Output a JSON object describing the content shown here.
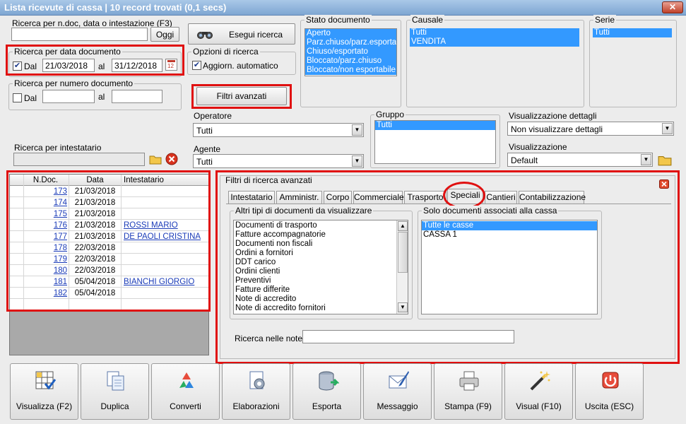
{
  "window": {
    "title": "Lista ricevute di cassa | 10 record trovati (0,1 secs)",
    "close": "✕"
  },
  "search": {
    "ndoc_label": "Ricerca per n.doc, data o intestazione (F3)",
    "ndoc_value": "",
    "oggi_label": "Oggi",
    "eseguiricerca_label": "Esegui ricerca",
    "date_group_label": "Ricerca per data documento",
    "date_dal_label": "Dal",
    "date_dal_checked": true,
    "date_from": "21/03/2018",
    "date_al_label": "al",
    "date_to": "31/12/2018",
    "calendar_icon_text": "12",
    "number_group_label": "Ricerca per numero documento",
    "num_dal_label": "Dal",
    "num_dal_checked": false,
    "num_from": "",
    "num_al_label": "al",
    "num_to": "",
    "intestatario_label": "Ricerca per intestatario",
    "intestatario_value": ""
  },
  "options": {
    "group_label": "Opzioni di ricerca",
    "auto_update_label": "Aggiorn. automatico",
    "auto_update_checked": true,
    "filtri_avanzati_label": "Filtri avanzati"
  },
  "stato": {
    "label": "Stato documento",
    "items": [
      "Aperto",
      "Parz.chiuso/parz.esportato",
      "Chiuso/esportato",
      "Bloccato/parz.chiuso",
      "Bloccato/non esportabile"
    ]
  },
  "causale": {
    "label": "Causale",
    "items": [
      "Tutti",
      "VENDITA"
    ]
  },
  "serie": {
    "label": "Serie",
    "items": [
      "Tutti"
    ]
  },
  "operatore": {
    "label": "Operatore",
    "value": "Tutti"
  },
  "agente": {
    "label": "Agente",
    "value": "Tutti"
  },
  "gruppo": {
    "label": "Gruppo",
    "items": [
      "Tutti"
    ]
  },
  "vis_dettagli": {
    "label": "Visualizzazione dettagli",
    "value": "Non visualizzare dettagli"
  },
  "visualizzazione": {
    "label": "Visualizzazione",
    "value": "Default"
  },
  "grid": {
    "headers": [
      "",
      "N.Doc.",
      "Data",
      "Intestatario"
    ],
    "rows": [
      {
        "ndoc": "173",
        "data": "21/03/2018",
        "intestatario": ""
      },
      {
        "ndoc": "174",
        "data": "21/03/2018",
        "intestatario": ""
      },
      {
        "ndoc": "175",
        "data": "21/03/2018",
        "intestatario": ""
      },
      {
        "ndoc": "176",
        "data": "21/03/2018",
        "intestatario": "ROSSI MARIO"
      },
      {
        "ndoc": "177",
        "data": "21/03/2018",
        "intestatario": "DE PAOLI CRISTINA"
      },
      {
        "ndoc": "178",
        "data": "22/03/2018",
        "intestatario": ""
      },
      {
        "ndoc": "179",
        "data": "22/03/2018",
        "intestatario": ""
      },
      {
        "ndoc": "180",
        "data": "22/03/2018",
        "intestatario": ""
      },
      {
        "ndoc": "181",
        "data": "05/04/2018",
        "intestatario": "BIANCHI GIORGIO"
      },
      {
        "ndoc": "182",
        "data": "05/04/2018",
        "intestatario": ""
      }
    ]
  },
  "advanced": {
    "label": "Filtri di ricerca avanzati",
    "tabs": [
      "Intestatario",
      "Amministr.",
      "Corpo",
      "Commerciale",
      "Trasporto",
      "Speciali",
      "Cantieri",
      "Contabilizzazione"
    ],
    "active_tab": "Speciali",
    "altri_label": "Altri tipi di documenti da visualizzare",
    "altri_items": [
      "Documenti di trasporto",
      "Fatture accompagnatorie",
      "Documenti non fiscali",
      "Ordini a fornitori",
      "DDT carico",
      "Ordini clienti",
      "Preventivi",
      "Fatture differite",
      "Note di accredito",
      "Note di accredito fornitori"
    ],
    "solo_label": "Solo documenti associati alla cassa",
    "solo_items": [
      "Tutte le casse",
      "CASSA 1"
    ],
    "note_label": "Ricerca nelle note",
    "note_value": ""
  },
  "toolbar": {
    "buttons": [
      "Visualizza (F2)",
      "Duplica",
      "Converti",
      "Elaborazioni",
      "Esporta",
      "Messaggio",
      "Stampa (F9)",
      "Visual (F10)",
      "Uscita (ESC)"
    ]
  },
  "colors": {
    "accent": "#3399ff",
    "highlight_box": "#e01010",
    "link": "#1a3bb8"
  }
}
